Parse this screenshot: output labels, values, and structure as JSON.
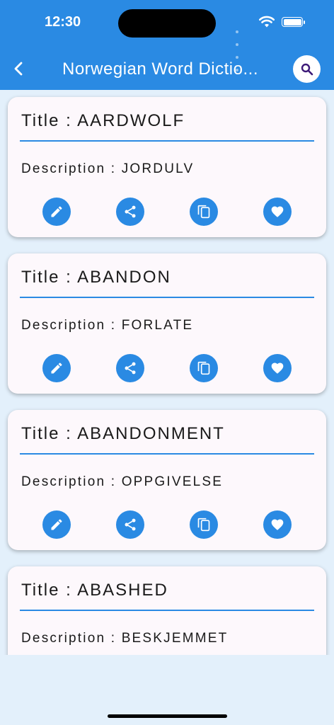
{
  "status_bar": {
    "time": "12:30"
  },
  "header": {
    "title": "Norwegian Word Dictio..."
  },
  "label_prefix": {
    "title": "Title : ",
    "description": "Description : "
  },
  "words": [
    {
      "title": "AARDWOLF",
      "description": "JORDULV"
    },
    {
      "title": "ABANDON",
      "description": "FORLATE"
    },
    {
      "title": "ABANDONMENT",
      "description": "OPPGIVELSE"
    },
    {
      "title": "ABASHED",
      "description": "BESKJEMMET"
    }
  ],
  "actions": [
    "edit-icon",
    "share-icon",
    "copy-icon",
    "favorite-icon"
  ],
  "colors": {
    "accent": "#2a8ae3",
    "background": "#e3f0fb",
    "card": "#fdf8fc"
  }
}
